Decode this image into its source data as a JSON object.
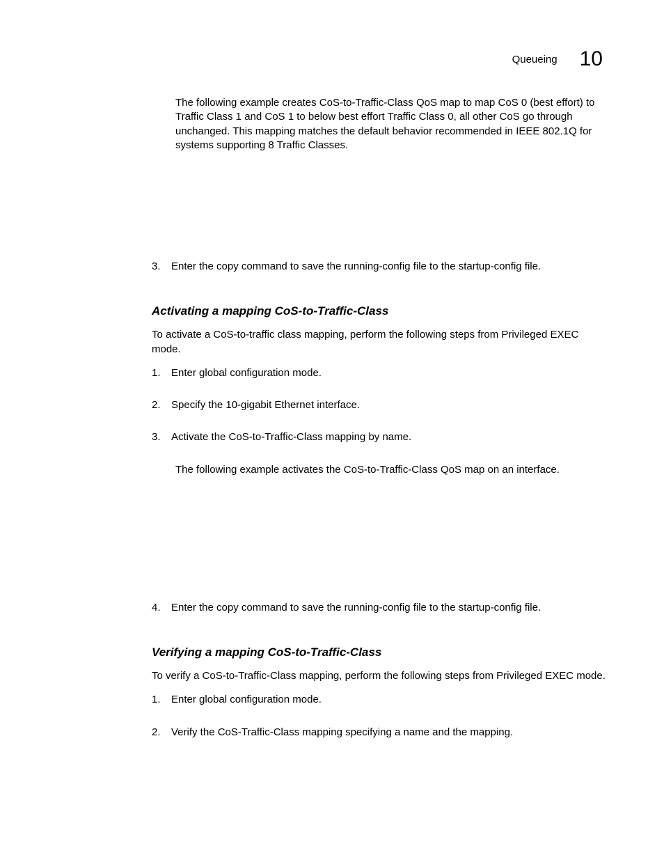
{
  "header": {
    "title": "Queueing",
    "chapterNumber": "10"
  },
  "introPara": "The following example creates CoS-to-Traffic-Class QoS map to map CoS 0 (best effort) to Traffic Class 1 and CoS 1 to below best effort Traffic Class 0, all other CoS go through unchanged. This mapping matches the default behavior recommended in IEEE 802.1Q for systems supporting 8 Traffic Classes.",
  "introStep": {
    "num": "3.",
    "text": "Enter the copy command to save the running-config file to the startup-config file."
  },
  "section1": {
    "heading": "Activating a mapping CoS-to-Traffic-Class",
    "intro": "To activate a CoS-to-traffic class mapping, perform the following steps from Privileged EXEC mode.",
    "steps": [
      {
        "num": "1.",
        "text": "Enter global configuration mode."
      },
      {
        "num": "2.",
        "text": "Specify the 10-gigabit Ethernet interface."
      },
      {
        "num": "3.",
        "text": "Activate the CoS-to-Traffic-Class mapping by name."
      }
    ],
    "example": "The following example activates the CoS-to-Traffic-Class QoS map on an interface.",
    "step4": {
      "num": "4.",
      "text": "Enter the copy command to save the running-config file to the startup-config file."
    }
  },
  "section2": {
    "heading": "Verifying a mapping CoS-to-Traffic-Class",
    "intro": "To verify a CoS-to-Traffic-Class mapping, perform the following steps from Privileged EXEC mode.",
    "steps": [
      {
        "num": "1.",
        "text": "Enter global configuration mode."
      },
      {
        "num": "2.",
        "text": "Verify the CoS-Traffic-Class mapping specifying a name and the mapping."
      }
    ]
  }
}
